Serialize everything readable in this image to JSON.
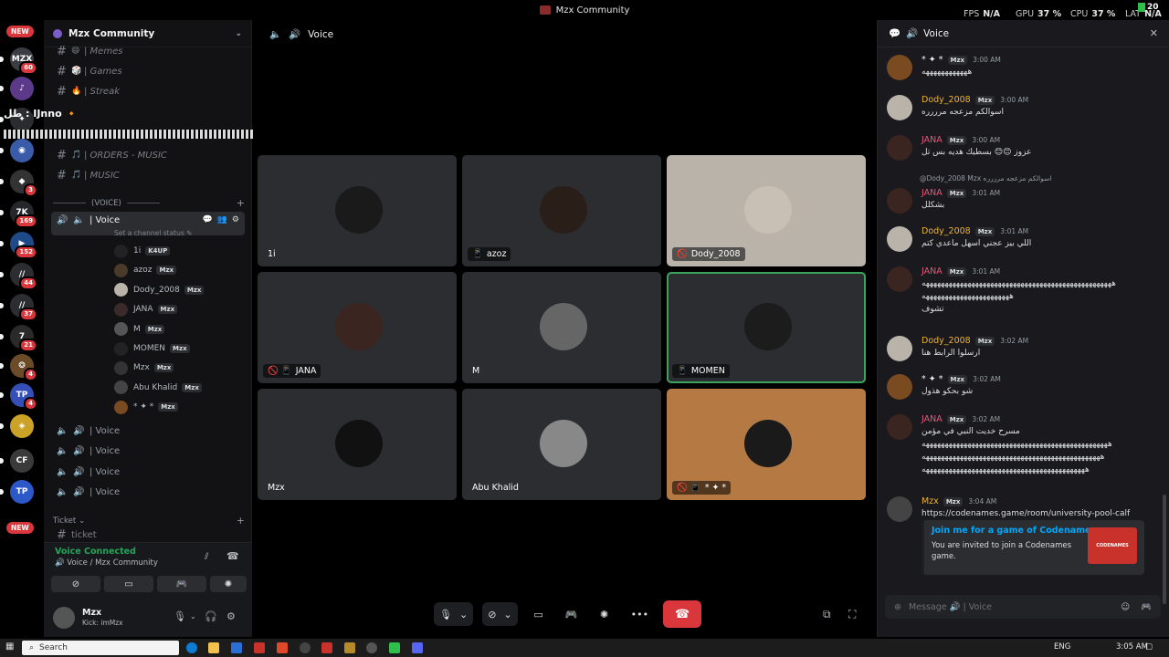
{
  "window": {
    "title": "Mzx Community"
  },
  "perf": [
    {
      "label": "FPS",
      "value": "N/A"
    },
    {
      "label": "GPU",
      "value": "37 %"
    },
    {
      "label": "CPU",
      "value": "37 %"
    },
    {
      "label": "LAT",
      "value": "N/A"
    }
  ],
  "corner_badge": "20",
  "rail": {
    "new_label": "NEW",
    "servers": [
      {
        "text": "MZX",
        "badge": "60",
        "color": "#3b3d44"
      },
      {
        "text": "♪",
        "badge": "",
        "color": "#5b3a8a"
      },
      {
        "text": "✦",
        "badge": "",
        "color": "#2a2c30"
      },
      {
        "text": "◉",
        "badge": "",
        "color": "#3a5ca8"
      },
      {
        "text": "◆",
        "badge": "3",
        "color": "#333"
      },
      {
        "text": "7K",
        "badge": "169",
        "color": "#26272b"
      },
      {
        "text": "▶",
        "badge": "152",
        "color": "#1f4a8a"
      },
      {
        "text": "//",
        "badge": "44",
        "color": "#2c2d31"
      },
      {
        "text": "//",
        "badge": "37",
        "color": "#2c2d31"
      },
      {
        "text": "7",
        "badge": "21",
        "color": "#2a2a2a"
      },
      {
        "text": "❂",
        "badge": "4",
        "color": "#6b4b28"
      },
      {
        "text": "TP",
        "badge": "4",
        "color": "#3450b8"
      },
      {
        "text": "◈",
        "badge": "",
        "color": "#c9a227"
      },
      {
        "text": "CF",
        "badge": "",
        "color": "#3a3a3a"
      },
      {
        "text": "TP",
        "badge": "",
        "color": "#2d58c8"
      }
    ]
  },
  "sidebar": {
    "guild_name": "Mzx Community",
    "text_channels": [
      {
        "emoji": "😄",
        "name": "| Memes"
      },
      {
        "emoji": "🎲",
        "name": "| Games"
      },
      {
        "emoji": "🔥",
        "name": "| Streak"
      }
    ],
    "music_channels": [
      {
        "name": "| ORDERS - MUSIC"
      },
      {
        "name": "| MUSIC"
      }
    ],
    "voice_category": "(VOICE)",
    "active_voice": {
      "name": "| Voice",
      "status": "Set a channel status ✎"
    },
    "voice_users": [
      {
        "name": "1i",
        "tag": "K4UP",
        "color": "#222",
        "muted": false
      },
      {
        "name": "azoz",
        "tag": "Mzx",
        "color": "#4a3a2a",
        "muted": false
      },
      {
        "name": "Dody_2008",
        "tag": "Mzx",
        "color": "#b9b3aa",
        "muted": true
      },
      {
        "name": "JANA",
        "tag": "Mzx",
        "color": "#3a2a2a",
        "muted": true
      },
      {
        "name": "M",
        "tag": "Mzx",
        "color": "#555",
        "muted": false
      },
      {
        "name": "MOMEN",
        "tag": "Mzx",
        "color": "#222",
        "muted": false
      },
      {
        "name": "Mzx",
        "tag": "Mzx",
        "color": "#333",
        "muted": false
      },
      {
        "name": "Abu Khalid",
        "tag": "Mzx",
        "color": "#444",
        "muted": false
      },
      {
        "name": "* ✦ *",
        "tag": "Mzx",
        "color": "#7a4a20",
        "muted": true
      }
    ],
    "other_voice": [
      "| Voice",
      "| Voice",
      "| Voice",
      "| Voice"
    ],
    "ticket_category": "Ticket",
    "ticket_channel": "ticket"
  },
  "overlay": {
    "text": "طل : IJnno 🔸"
  },
  "voice_panel": {
    "status": "Voice Connected",
    "location": "Voice / Mzx Community"
  },
  "user_panel": {
    "name": "Mzx",
    "sub": "Kick: imMzx"
  },
  "main": {
    "channel": "Voice",
    "tiles": [
      {
        "name": "1i",
        "bg": "#2b2d31",
        "av": "#1a1a1a",
        "flags": "",
        "speaking": false
      },
      {
        "name": "azoz",
        "bg": "#2b2d31",
        "av": "#2a1f18",
        "flags": "📱",
        "speaking": false
      },
      {
        "name": "Dody_2008",
        "bg": "#b9b3aa",
        "av": "#c8c0b4",
        "flags": "🚫",
        "speaking": false
      },
      {
        "name": "JANA",
        "bg": "#2b2d31",
        "av": "#3a2520",
        "flags": "🚫 📱",
        "speaking": false
      },
      {
        "name": "M",
        "bg": "#2b2d31",
        "av": "#666",
        "flags": "",
        "speaking": false
      },
      {
        "name": "MOMEN",
        "bg": "#2b2d31",
        "av": "#1c1c1c",
        "flags": "📱",
        "speaking": true
      },
      {
        "name": "Mzx",
        "bg": "#2b2d31",
        "av": "#111",
        "flags": "",
        "speaking": false
      },
      {
        "name": "Abu Khalid",
        "bg": "#2b2d31",
        "av": "#888",
        "flags": "",
        "speaking": false
      },
      {
        "name": "* ✦ *",
        "bg": "#b57a44",
        "av": "#1a1a1a",
        "flags": "🚫 📱",
        "speaking": false
      }
    ]
  },
  "chat": {
    "title": "Voice",
    "messages": [
      {
        "name": "* ✦ *",
        "name_class": "n-white",
        "tag": "Mzx",
        "time": "3:00 AM",
        "text": "ههههههههههههه",
        "av": "#7a4a20"
      },
      {
        "name": "Dody_2008",
        "name_class": "n-gold",
        "tag": "Mzx",
        "time": "3:00 AM",
        "text": "اسوالكم مزعجه مرررره",
        "av": "#b9b3aa"
      },
      {
        "name": "JANA",
        "name_class": "n-pink",
        "tag": "Mzx",
        "time": "3:00 AM",
        "text": "عزوز 😊😊 بسطيك هديه بس تل",
        "av": "#3a2520"
      },
      {
        "name": "JANA",
        "name_class": "n-pink",
        "tag": "Mzx",
        "time": "3:01 AM",
        "text": "بشكلل",
        "av": "#3a2520",
        "reply": "@Dody_2008  Mzx  اسوالكم مزعجه مرررره"
      },
      {
        "name": "Dody_2008",
        "name_class": "n-gold",
        "tag": "Mzx",
        "time": "3:01 AM",
        "text": "اللي بيز عجني اسهل ماعدي كتم",
        "av": "#b9b3aa"
      },
      {
        "name": "JANA",
        "name_class": "n-pink",
        "tag": "Mzx",
        "time": "3:01 AM",
        "text": "ههههههههههههههههههههههههههههههههههههههههههههههههههه",
        "text2": "هههههههههههههههههههههههه",
        "text3": "تشوف",
        "av": "#3a2520"
      },
      {
        "name": "Dody_2008",
        "name_class": "n-gold",
        "tag": "Mzx",
        "time": "3:02 AM",
        "text": "ارسلوا الرابط هنا",
        "av": "#b9b3aa"
      },
      {
        "name": "* ✦ *",
        "name_class": "n-white",
        "tag": "Mzx",
        "time": "3:02 AM",
        "text": "شو بحكو هذول",
        "av": "#7a4a20"
      },
      {
        "name": "JANA",
        "name_class": "n-pink",
        "tag": "Mzx",
        "time": "3:02 AM",
        "text": "مسرح خديت النبي في مؤمن",
        "text2": "هههههههههههههههههههههههههههههههههههههههههههههههههه",
        "text3": "هههههههههههههههههههههههههههههههههههههههههههههههه",
        "text4": "هههههههههههههههههههههههههههههههههههههههههههه",
        "av": "#3a2520"
      },
      {
        "name": "Mzx",
        "name_class": "n-gold",
        "tag": "Mzx",
        "time": "3:04 AM",
        "text": "https://codenames.game/room/university-pool-calf",
        "av": "#444",
        "is_link": true
      }
    ],
    "embed": {
      "title": "Join me for a game of Codenames",
      "desc": "You are invited to join a Codenames game.",
      "img_text": "CODENAMES"
    },
    "input_placeholder": "Message 🔊 | Voice"
  },
  "taskbar": {
    "search": "Search",
    "lang": "ENG",
    "time": "3:05 AM"
  }
}
